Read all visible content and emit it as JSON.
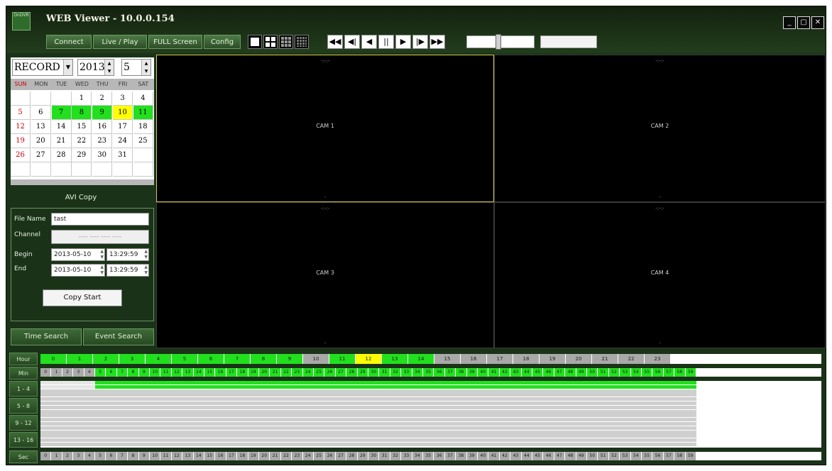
{
  "window": {
    "title": "WEB Viewer - 10.0.0.154",
    "logo_text": "OnDVR"
  },
  "toolbar": {
    "buttons": [
      "Connect",
      "Live / Play",
      "FULL Screen",
      "Config"
    ]
  },
  "calendar": {
    "mode": "RECORD",
    "year": "2013",
    "month": "5",
    "weekdays": [
      "SUN",
      "MON",
      "TUE",
      "WED",
      "THU",
      "FRI",
      "SAT"
    ],
    "weeks": [
      [
        "",
        "",
        "",
        "1",
        "2",
        "3",
        "4"
      ],
      [
        "5",
        "6",
        "7",
        "8",
        "9",
        "10",
        "11"
      ],
      [
        "12",
        "13",
        "14",
        "15",
        "16",
        "17",
        "18"
      ],
      [
        "19",
        "20",
        "21",
        "22",
        "23",
        "24",
        "25"
      ],
      [
        "26",
        "27",
        "28",
        "29",
        "30",
        "31",
        ""
      ],
      [
        "",
        "",
        "",
        "",
        "",
        "",
        ""
      ]
    ],
    "recorded_days": [
      "7",
      "8",
      "9",
      "11"
    ],
    "selected_day": "10",
    "colors": {
      "recorded": "#22e01e",
      "selected": "#ffff00",
      "sunday": "#cc0000"
    }
  },
  "avi_copy": {
    "title": "AVI Copy",
    "file_name_label": "File Name",
    "file_name_value": "tast",
    "channel_label": "Channel",
    "channel_value": "---- ---- ---- ----",
    "begin_label": "Begin",
    "begin_date": "2013-05-10",
    "begin_time": "13:29:59",
    "end_label": "End",
    "end_date": "2013-05-10",
    "end_time": "13:29:59",
    "copy_button": "Copy Start"
  },
  "tabs": {
    "time_search": "Time Search",
    "event_search": "Event Search"
  },
  "cameras": [
    "CAM 1",
    "CAM 2",
    "CAM 3",
    "CAM 4"
  ],
  "timeline": {
    "hour_label": "Hour",
    "min_label": "Min",
    "sec_label": "Sec",
    "channel_labels": [
      "1 - 4",
      "5 - 8",
      "9 - 12",
      "13 - 16"
    ],
    "hours": [
      "0",
      "1",
      "2",
      "3",
      "4",
      "5",
      "6",
      "7",
      "8",
      "9",
      "10",
      "11",
      "12",
      "13",
      "14",
      "15",
      "16",
      "17",
      "18",
      "19",
      "20",
      "21",
      "22",
      "23"
    ],
    "recorded_hours": [
      0,
      1,
      2,
      3,
      4,
      5,
      6,
      7,
      8,
      9,
      11,
      13,
      14
    ],
    "selected_hour": 12,
    "recorded_minutes": [
      5,
      6,
      7,
      8,
      9,
      10,
      11,
      12,
      13,
      14,
      15,
      16,
      17,
      18,
      19,
      20,
      21,
      22,
      23,
      24,
      25,
      26,
      27,
      28,
      29,
      30,
      31,
      32,
      33,
      34,
      35,
      36,
      37,
      38,
      39,
      40,
      41,
      42,
      43,
      44,
      45,
      46,
      47,
      48,
      49,
      50,
      51,
      52,
      53,
      54,
      55,
      56,
      57,
      58,
      59
    ],
    "colors": {
      "recorded": "#22e01e",
      "selected": "#ffff00",
      "empty": "#a9a9a9"
    }
  }
}
